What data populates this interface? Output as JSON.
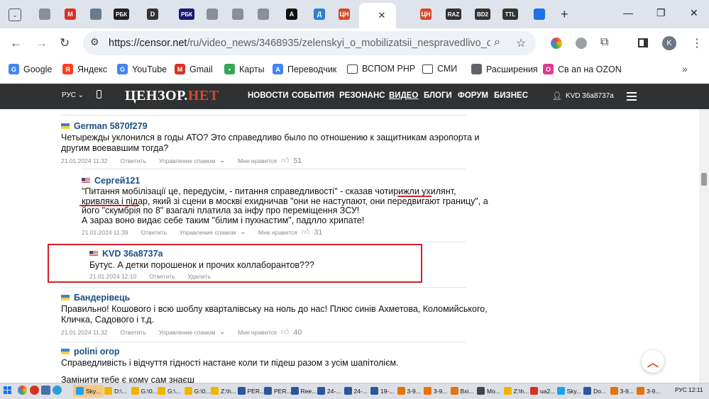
{
  "browser": {
    "tabs": [
      {
        "name": "tab-1",
        "icon": "globe-tab-icon",
        "text": "",
        "color": "#8a8f99"
      },
      {
        "name": "tab-2",
        "icon": "gmail-tab-icon",
        "text": "M",
        "color": "#d93025"
      },
      {
        "name": "tab-3",
        "icon": "building-tab-icon",
        "text": "",
        "color": "#6b7b8c"
      },
      {
        "name": "tab-4",
        "icon": "rbc-tab-icon",
        "text": "РБК",
        "color": "#222222"
      },
      {
        "name": "tab-5",
        "icon": "d-tab-icon",
        "text": "D",
        "color": "#333333"
      },
      {
        "name": "tab-6",
        "icon": "rbk-tab-icon",
        "text": "РБК",
        "color": "#1a1a6e"
      },
      {
        "name": "tab-7",
        "icon": "globe-tab-icon",
        "text": "",
        "color": "#8a8f99"
      },
      {
        "name": "tab-8",
        "icon": "globe-tab-icon",
        "text": "",
        "color": "#8a8f99"
      },
      {
        "name": "tab-9",
        "icon": "globe-tab-icon",
        "text": "",
        "color": "#8a8f99"
      },
      {
        "name": "tab-10",
        "icon": "a-tab-icon",
        "text": "A",
        "color": "#111111"
      },
      {
        "name": "tab-11",
        "icon": "d-blue-tab-icon",
        "text": "Д",
        "color": "#2a7fd4"
      },
      {
        "name": "tab-12",
        "icon": "censor-tab-icon",
        "text": "ЦН",
        "color": "#d44a2a"
      },
      {
        "name": "tab-13",
        "icon": "censor-tab-icon",
        "text": "ЦН",
        "color": "#d44a2a"
      },
      {
        "name": "tab-14",
        "icon": "censor-tab-icon",
        "text": "ЦН",
        "color": "#d44a2a"
      },
      {
        "name": "tab-15",
        "icon": "raz-tab-icon",
        "text": "RAZ",
        "color": "#333333"
      },
      {
        "name": "tab-16",
        "icon": "bd2-tab-icon",
        "text": "BD2",
        "color": "#333333"
      },
      {
        "name": "tab-17",
        "icon": "ttl-tab-icon",
        "text": "TTL",
        "color": "#333333"
      },
      {
        "name": "tab-18",
        "icon": "extension-tab-icon",
        "text": "",
        "color": "#1a73e8"
      }
    ],
    "url_host": "https://censor.net",
    "url_path": "/ru/video_news/3468935/zelenskyi_o_mobilizatsii_nespravedlivo_obh...",
    "bookmarks": [
      {
        "label": "Google",
        "icon": "google-icon",
        "color": "#4285f4",
        "glyph": "G"
      },
      {
        "label": "Яндекс",
        "icon": "yandex-icon",
        "color": "#fc3f1d",
        "glyph": "Я"
      },
      {
        "label": "YouTube",
        "icon": "youtube-icon",
        "color": "#4285f4",
        "glyph": "G"
      },
      {
        "label": "Gmail",
        "icon": "gmail-icon",
        "color": "#d93025",
        "glyph": "M"
      },
      {
        "label": "Карты",
        "icon": "maps-pin-icon",
        "color": "#34a853",
        "glyph": "•"
      },
      {
        "label": "Переводчик",
        "icon": "translate-icon",
        "color": "#4285f4",
        "glyph": "A"
      },
      {
        "label": "ВСПОМ PHP",
        "icon": "folder-icon",
        "color": "#ffffff",
        "glyph": ""
      },
      {
        "label": "СМИ",
        "icon": "folder-icon",
        "color": "#ffffff",
        "glyph": ""
      },
      {
        "label": "Расширения",
        "icon": "puzzle-icon",
        "color": "#5f6368",
        "glyph": ""
      },
      {
        "label": "Св ап на OZON",
        "icon": "ozon-icon",
        "color": "#e03a8b",
        "glyph": "O"
      }
    ]
  },
  "site": {
    "lang": "РУС",
    "logo_main": "ЦЕНЗОР.",
    "logo_net": "НЕТ",
    "nav": [
      "НОВОСТИ",
      "СОБЫТИЯ",
      "РЕЗОНАНС",
      "ВИДЕО",
      "БЛОГИ",
      "ФОРУМ",
      "БИЗНЕС"
    ],
    "user": "KVD 36a8737a"
  },
  "comments": [
    {
      "author": "German 5870f279",
      "flag": "ua",
      "lines": [
        "Четырежды уклонился в годы АТО? Это справедливо было по отношению к защитникам аэропорта и",
        "другим воевавшим тогда?"
      ],
      "date": "21.01.2024 11:32",
      "reply": "Ответить",
      "spam": "Управление спамом",
      "like_label": "Мне нравится",
      "likes": "51"
    },
    {
      "author": "Сергей121",
      "flag": "us",
      "lines": [
        "\"Питання мобілізації це, передусім, - питання справедливості\" - сказав чотирижли ухилянт,",
        "кривляка і підар, який зі сцени в москві ехидничав \"они не наступают, они передвигают границу\", а",
        "його \"скумбрія по 8\" взагалі платила за інфу про переміщення ЗСУ!",
        "А зараз воно видає себе таким \"білим і пухнастим\", падлло хрипате!"
      ],
      "date": "21.01.2024 11:39",
      "reply": "Ответить",
      "spam": "Управление спамом",
      "like_label": "Мне нравится",
      "likes": "31"
    },
    {
      "author": "KVD 36a8737a",
      "flag": "us",
      "lines": [
        "Бутус. А детки порошенок и прочих коллаборантов???"
      ],
      "date": "21.01.2024 12:10",
      "reply": "Ответить",
      "delete": "Удалить"
    },
    {
      "author": "Бандерівець",
      "flag": "ua",
      "lines": [
        "Правильно! Кошового і всю шоблу кварталівську на ноль до нас! Плюс синів Ахметова, Коломийського,",
        "Кличка, Садового і т.д."
      ],
      "date": "21.01.2024 11:32",
      "reply": "Ответить",
      "spam": "Управление спамом",
      "like_label": "Мне нравится",
      "likes": "40"
    },
    {
      "author": "polini orop",
      "flag": "ua",
      "lines": [
        "Справедливість і відчуття гідності настане коли ти підеш разом з усім шапітолієм.",
        "",
        "Замінити тебе є кому сам знаєш"
      ]
    }
  ],
  "taskbar": {
    "items": [
      "Sky...",
      "D:\\...",
      "G:\\0...",
      "G:\\...",
      "G:\\0...",
      "Z:\\h...",
      "PER...",
      "PER...",
      "Ree...",
      "24-...",
      "24-...",
      "19-...",
      "3-9...",
      "3-9...",
      "Bxi...",
      "Mo...",
      "Z:\\h...",
      "ua2...",
      "Sky...",
      "Do...",
      "3-9...",
      "3-9..."
    ],
    "lang": "РУС",
    "time": "12:11"
  }
}
